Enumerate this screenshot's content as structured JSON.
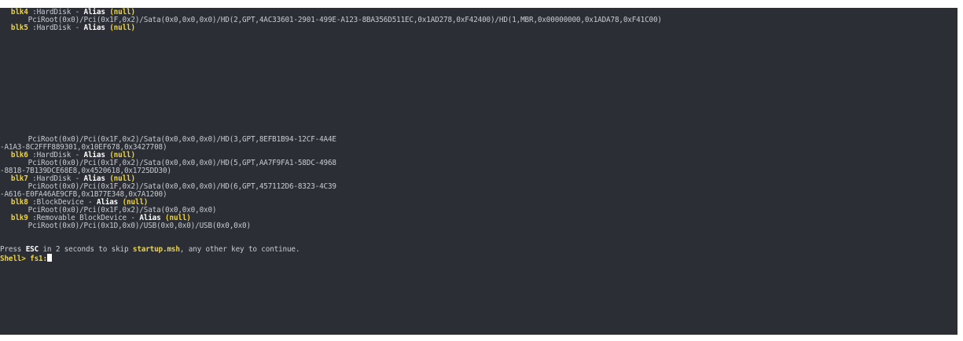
{
  "blocks": {
    "blk4": {
      "name": "blk4",
      "type": " :HardDisk - ",
      "alias_label": "Alias",
      "alias_value": "(null)",
      "path": "      PciRoot(0x0)/Pci(0x1F,0x2)/Sata(0x0,0x0,0x0)/HD(2,GPT,4AC33601-2901-499E-A123-8BA356D511EC,0x1AD278,0xF42400)/HD(1,MBR,0x00000000,0x1ADA78,0xF41C00)"
    },
    "blk5": {
      "name": "blk5",
      "type": " :HardDisk - ",
      "alias_label": "Alias",
      "alias_value": "(null)",
      "path": "      PciRoot(0x0)/Pci(0x1F,0x2)/Sata(0x0,0x0,0x0)/HD(3,GPT,8EFB1B94-12CF-4A4E",
      "path_cont": "-A1A3-8C2FFF889301,0x10EF678,0x3427708)"
    },
    "blk6": {
      "name": "blk6",
      "type": " :HardDisk - ",
      "alias_label": "Alias",
      "alias_value": "(null)",
      "path": "      PciRoot(0x0)/Pci(0x1F,0x2)/Sata(0x0,0x0,0x0)/HD(5,GPT,AA7F9FA1-58DC-4968",
      "path_cont": "-8818-7B139DCE68E8,0x4520618,0x1725DD30)"
    },
    "blk7": {
      "name": "blk7",
      "type": " :HardDisk - ",
      "alias_label": "Alias",
      "alias_value": "(null)",
      "path": "      PciRoot(0x0)/Pci(0x1F,0x2)/Sata(0x0,0x0,0x0)/HD(6,GPT,457112D6-8323-4C39",
      "path_cont": "-A616-E0FA46AE9CFB,0x1B77E348,0x7A1200)"
    },
    "blk8": {
      "name": "blk8",
      "type": " :BlockDevice - ",
      "alias_label": "Alias",
      "alias_value": "(null)",
      "path": "      PciRoot(0x0)/Pci(0x1F,0x2)/Sata(0x0,0x0,0x0)"
    },
    "blk9": {
      "name": "blk9",
      "type": " :Removable BlockDevice - ",
      "alias_label": "Alias",
      "alias_value": "(null)",
      "path": "      PciRoot(0x0)/Pci(0x1D,0x0)/USB(0x0,0x0)/USB(0x0,0x0)"
    }
  },
  "startup": {
    "pre": "Press ",
    "key": "ESC",
    "mid1": " in 2 seconds to skip ",
    "script": "startup.msh",
    "post": ", any other key to continue."
  },
  "prompt": {
    "text": "Shell> ",
    "command": "fs1:"
  },
  "colors": {
    "background": "#2b2e34",
    "text": "#c8ccd2",
    "highlight": "#f2d534",
    "bold": "#ffffff"
  }
}
